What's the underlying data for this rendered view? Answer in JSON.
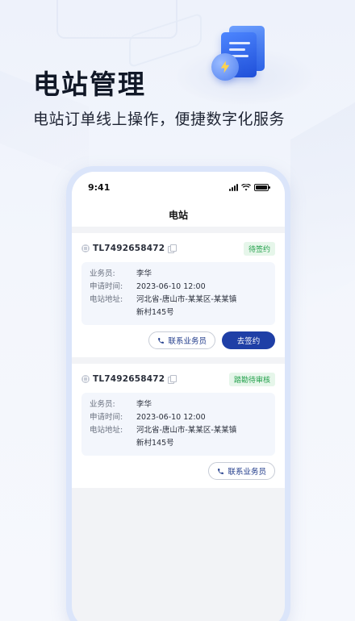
{
  "hero": {
    "title": "电站管理",
    "subtitle": "电站订单线上操作，便捷数字化服务"
  },
  "status_bar": {
    "time": "9:41"
  },
  "nav": {
    "title": "电站"
  },
  "orders": [
    {
      "id": "TL7492658472",
      "status": "待签约",
      "salesperson_label": "业务员:",
      "salesperson": "李华",
      "apply_time_label": "申请时间:",
      "apply_time": "2023-06-10 12:00",
      "address_label": "电站地址:",
      "address_line1": "河北省-唐山市-某某区-某某镇",
      "address_line2": "新村145号",
      "contact_label": "联系业务员",
      "primary_label": "去签约"
    },
    {
      "id": "TL7492658472",
      "status": "踏勘待审核",
      "salesperson_label": "业务员:",
      "salesperson": "李华",
      "apply_time_label": "申请时间:",
      "apply_time": "2023-06-10 12:00",
      "address_label": "电站地址:",
      "address_line1": "河北省-唐山市-某某区-某某镇",
      "address_line2": "新村145号",
      "contact_label": "联系业务员"
    }
  ],
  "colors": {
    "primary": "#1f3fa6",
    "badge_green": "#22a04b",
    "badge_green_bg": "#e6f6ea",
    "phone_frame": "#dbe5fa"
  },
  "icons": {
    "hero": "document-lightning-icon",
    "id": "order-id-icon",
    "copy": "copy-icon",
    "phone": "phone-icon"
  }
}
